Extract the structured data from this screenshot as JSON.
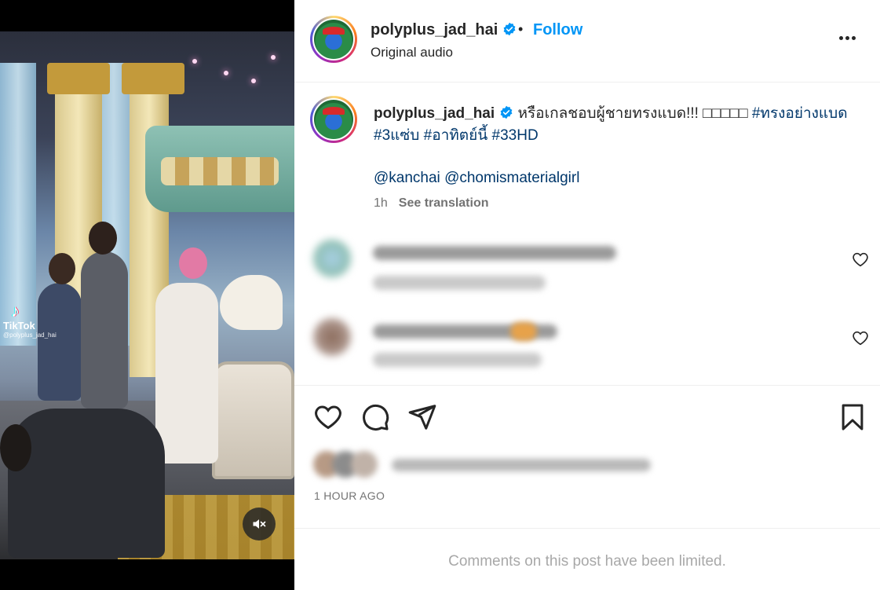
{
  "media": {
    "watermark_brand": "TikTok",
    "watermark_user": "@polyplus_jad_hai",
    "mute_icon": "speaker-muted-icon"
  },
  "header": {
    "username": "polyplus_jad_hai",
    "verified_icon": "verified-badge-icon",
    "separator": "•",
    "follow_label": "Follow",
    "audio_label": "Original audio",
    "more_icon": "more-options-icon"
  },
  "caption": {
    "username": "polyplus_jad_hai",
    "text": "หรือเกลชอบผู้ชายทรงแบด!!! □□□□□",
    "hashtags": [
      "#ทรงอย่างแบด",
      "#3แซ่บ",
      "#อาทิตย์นี้",
      "#33HD"
    ],
    "mentions": [
      "@kanchai",
      "@chomismaterialgirl"
    ],
    "time": "1h",
    "see_translation": "See translation"
  },
  "comments": [
    {
      "username": "",
      "text": ""
    },
    {
      "username": "",
      "text": ""
    }
  ],
  "actions": {
    "like_icon": "heart-icon",
    "comment_icon": "comment-icon",
    "share_icon": "share-icon",
    "save_icon": "bookmark-icon"
  },
  "post": {
    "timestamp": "1 HOUR AGO",
    "comments_limited": "Comments on this post have been limited."
  },
  "colors": {
    "link_blue": "#0095f6",
    "hashtag_blue": "#00376b",
    "muted_text": "#737373",
    "verified_blue": "#0095f6"
  }
}
